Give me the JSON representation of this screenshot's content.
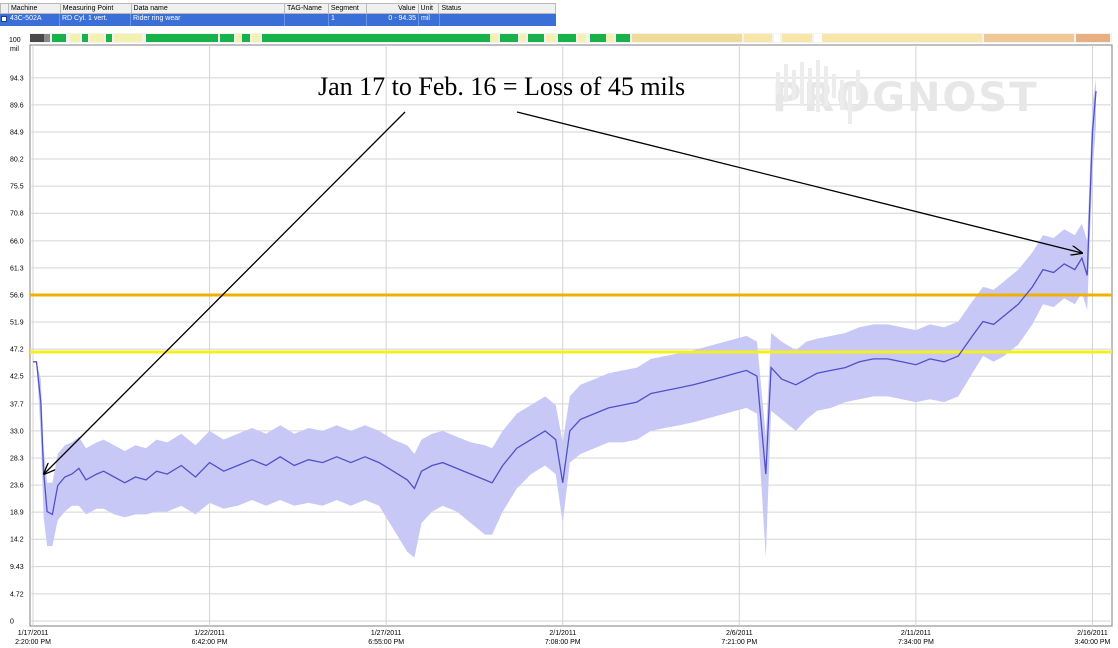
{
  "table": {
    "headers": [
      "Machine",
      "Measuring Point",
      "Data name",
      "TAG-Name",
      "Segment",
      "Value",
      "Unit",
      "Status"
    ],
    "row": {
      "machine": "43C-502A",
      "measuring_point": "RD Cyl. 1 vert.",
      "data_name": "Rider ring wear",
      "tag_name": "",
      "segment": "1",
      "value": "0 - 94.35",
      "unit": "mil",
      "status": ""
    }
  },
  "watermark": "PROGNOST",
  "annotation": "Jan 17 to Feb. 16 = Loss of 45 mils",
  "colors": {
    "band": "#c8c8f7",
    "line": "#5050c8",
    "threshold_high": "#f0b000",
    "threshold_low": "#f4f01e",
    "grid": "#d4d4d4"
  },
  "chart_data": {
    "type": "line",
    "title": "",
    "xlabel": "",
    "ylabel": "mil",
    "y_axis_top_label": "100",
    "ylim": [
      0,
      100
    ],
    "yticks": [
      "94.3",
      "89.6",
      "84.9",
      "80.2",
      "75.5",
      "70.8",
      "66.0",
      "61.3",
      "56.6",
      "51.9",
      "47.2",
      "42.5",
      "37.7",
      "33.0",
      "28.3",
      "23.6",
      "18.9",
      "14.2",
      "9.43",
      "4.72",
      "0"
    ],
    "ytick_values": [
      94.3,
      89.6,
      84.9,
      80.2,
      75.5,
      70.8,
      66.0,
      61.3,
      56.6,
      51.9,
      47.2,
      42.5,
      37.7,
      33.0,
      28.3,
      23.6,
      18.9,
      14.2,
      9.43,
      4.72,
      0
    ],
    "x_range_days": [
      0,
      30.1
    ],
    "xticks": [
      {
        "day": 0.0,
        "date": "1/17/2011",
        "time": "2:20:00 PM"
      },
      {
        "day": 5.0,
        "date": "1/22/2011",
        "time": "6:42:00 PM"
      },
      {
        "day": 10.0,
        "date": "1/27/2011",
        "time": "6:55:00 PM"
      },
      {
        "day": 15.0,
        "date": "2/1/2011",
        "time": "7:08:00 PM"
      },
      {
        "day": 20.0,
        "date": "2/6/2011",
        "time": "7:21:00 PM"
      },
      {
        "day": 25.0,
        "date": "2/11/2011",
        "time": "7:34:00 PM"
      },
      {
        "day": 30.0,
        "date": "2/16/2011",
        "time": "3:40:00 PM"
      }
    ],
    "thresholds": [
      {
        "value": 56.6,
        "level": "high"
      },
      {
        "value": 46.7,
        "level": "low"
      }
    ],
    "series": [
      {
        "x": [
          0.0,
          0.1,
          0.22,
          0.3,
          0.4,
          0.55,
          0.7,
          0.9,
          1.1,
          1.3,
          1.5,
          1.8,
          2.0,
          2.3,
          2.6,
          2.9,
          3.2,
          3.5,
          3.8,
          4.2,
          4.6,
          5.0,
          5.4,
          5.8,
          6.2,
          6.6,
          7.0,
          7.4,
          7.8,
          8.2,
          8.6,
          9.0,
          9.4,
          9.8,
          10.2,
          10.6,
          10.8,
          11.0,
          11.3,
          11.6,
          12.0,
          12.4,
          12.8,
          13.0,
          13.3,
          13.7,
          14.1,
          14.5,
          14.8,
          15.0,
          15.2,
          15.5,
          15.9,
          16.3,
          16.7,
          17.1,
          17.5,
          17.9,
          18.3,
          18.7,
          19.0,
          19.3,
          19.6,
          19.9,
          20.2,
          20.5,
          20.75,
          20.9,
          21.2,
          21.6,
          21.9,
          22.2,
          22.6,
          23.0,
          23.4,
          23.8,
          24.2,
          24.6,
          25.0,
          25.4,
          25.8,
          26.2,
          26.6,
          26.9,
          27.2,
          27.5,
          27.9,
          28.3,
          28.6,
          28.9,
          29.2,
          29.5,
          29.7,
          29.85,
          30.0,
          30.1
        ],
        "y": [
          45.0,
          45.0,
          38.0,
          26.0,
          19.0,
          18.5,
          23.5,
          25.0,
          25.5,
          26.5,
          24.5,
          25.5,
          26.0,
          25.0,
          24.0,
          25.0,
          24.5,
          26.0,
          25.5,
          27.0,
          25.0,
          27.5,
          26.0,
          27.0,
          28.0,
          27.0,
          28.5,
          27.0,
          28.0,
          27.5,
          28.5,
          27.5,
          28.5,
          27.5,
          26.0,
          24.5,
          23.0,
          26.0,
          27.0,
          27.5,
          26.5,
          25.5,
          24.5,
          24.0,
          27.0,
          30.0,
          31.5,
          33.0,
          31.5,
          24.0,
          33.0,
          35.0,
          36.0,
          37.0,
          37.5,
          38.0,
          39.5,
          40.0,
          40.5,
          41.0,
          41.5,
          42.0,
          42.5,
          43.0,
          43.5,
          42.5,
          25.5,
          44.0,
          42.0,
          41.0,
          42.0,
          43.0,
          43.5,
          44.0,
          45.0,
          45.5,
          45.5,
          45.0,
          44.5,
          45.5,
          45.0,
          46.0,
          49.5,
          52.0,
          51.5,
          53.0,
          55.0,
          58.0,
          61.0,
          60.5,
          62.0,
          61.0,
          63.0,
          60.0,
          85.0,
          92.0
        ],
        "low": [
          45.0,
          45.0,
          32.0,
          18.0,
          13.0,
          13.0,
          17.5,
          19.0,
          20.0,
          20.0,
          18.5,
          19.5,
          19.5,
          18.5,
          18.0,
          18.5,
          18.5,
          19.0,
          19.0,
          20.0,
          18.5,
          20.5,
          19.5,
          20.0,
          21.0,
          20.0,
          21.0,
          20.0,
          20.5,
          20.0,
          21.0,
          20.0,
          21.0,
          20.0,
          16.0,
          12.0,
          11.0,
          17.0,
          19.0,
          20.0,
          19.0,
          17.0,
          15.0,
          15.0,
          19.0,
          23.0,
          25.5,
          27.0,
          25.5,
          17.0,
          27.5,
          29.0,
          30.0,
          31.0,
          31.0,
          31.5,
          33.0,
          33.5,
          34.0,
          34.5,
          35.0,
          35.5,
          36.0,
          36.5,
          37.0,
          36.0,
          11.0,
          36.5,
          35.0,
          33.0,
          35.0,
          36.5,
          37.0,
          38.0,
          38.5,
          39.0,
          39.0,
          38.5,
          38.0,
          38.5,
          38.0,
          39.0,
          43.0,
          46.0,
          45.0,
          46.0,
          48.0,
          51.5,
          55.0,
          54.5,
          56.0,
          55.0,
          57.0,
          54.0,
          78.0,
          86.0
        ],
        "high": [
          45.0,
          45.0,
          42.0,
          30.0,
          24.0,
          24.0,
          29.0,
          30.5,
          31.0,
          32.0,
          30.0,
          31.0,
          31.5,
          30.5,
          29.5,
          30.5,
          30.0,
          31.5,
          31.0,
          32.5,
          30.5,
          33.0,
          31.5,
          32.5,
          33.5,
          32.5,
          34.0,
          32.5,
          33.5,
          33.0,
          34.0,
          33.0,
          34.0,
          33.0,
          31.5,
          30.5,
          29.0,
          31.5,
          32.5,
          33.0,
          32.0,
          31.0,
          30.5,
          30.0,
          33.0,
          36.0,
          37.5,
          39.0,
          37.5,
          31.0,
          39.0,
          41.0,
          42.0,
          43.0,
          43.5,
          44.0,
          45.5,
          46.0,
          46.5,
          47.0,
          47.5,
          48.0,
          48.5,
          49.0,
          49.5,
          48.5,
          32.0,
          50.0,
          48.5,
          47.0,
          48.5,
          49.0,
          49.5,
          50.0,
          51.0,
          51.5,
          51.5,
          51.0,
          50.5,
          51.5,
          51.0,
          52.0,
          55.5,
          58.0,
          57.5,
          59.0,
          61.0,
          64.0,
          67.0,
          66.5,
          68.0,
          67.0,
          69.0,
          66.0,
          90.0,
          94.0
        ]
      }
    ]
  }
}
